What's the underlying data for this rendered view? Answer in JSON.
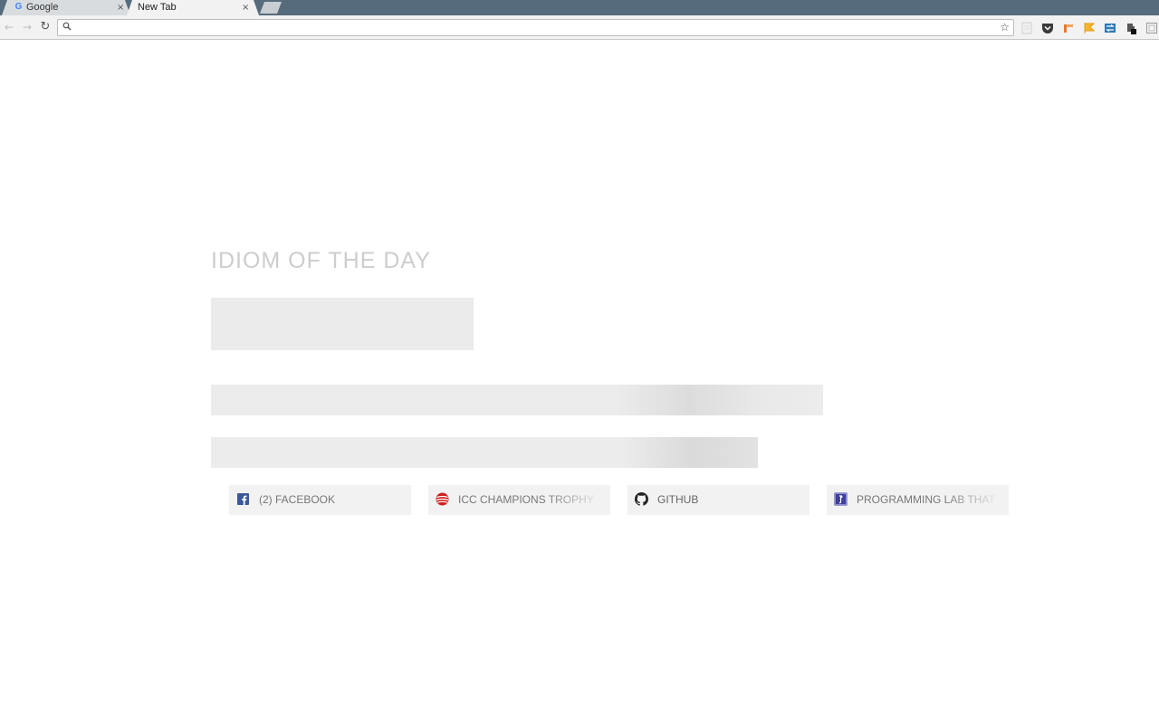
{
  "browser": {
    "tabs": [
      {
        "title": "Google",
        "favicon": "G",
        "close": "×"
      },
      {
        "title": "New Tab",
        "close": "×"
      }
    ],
    "toolbar": {
      "back": "←",
      "forward": "→",
      "reload": "↻",
      "omnibox": {
        "value": ""
      },
      "bookmark_star": "☆",
      "extensions": [
        "pdf-icon",
        "pocket-icon",
        "share-icon",
        "flag-icon",
        "sync-icon",
        "extension-badge-icon",
        "frame-icon"
      ]
    }
  },
  "page": {
    "idiom_heading": "IDIOM OF THE DAY",
    "top_sites": [
      {
        "label": "(2) FACEBOOK",
        "icon": "facebook-icon",
        "icon_color": "#3b5998"
      },
      {
        "label": "ICC CHAMPIONS TROPHY",
        "icon": "icc-icon",
        "icon_color": "#d0201f"
      },
      {
        "label": "GITHUB",
        "icon": "github-icon",
        "icon_color": "#222222"
      },
      {
        "label": "PROGRAMMING LAB THAT",
        "icon": "programming-lab-icon",
        "icon_color": "#3f3f9e"
      }
    ]
  }
}
